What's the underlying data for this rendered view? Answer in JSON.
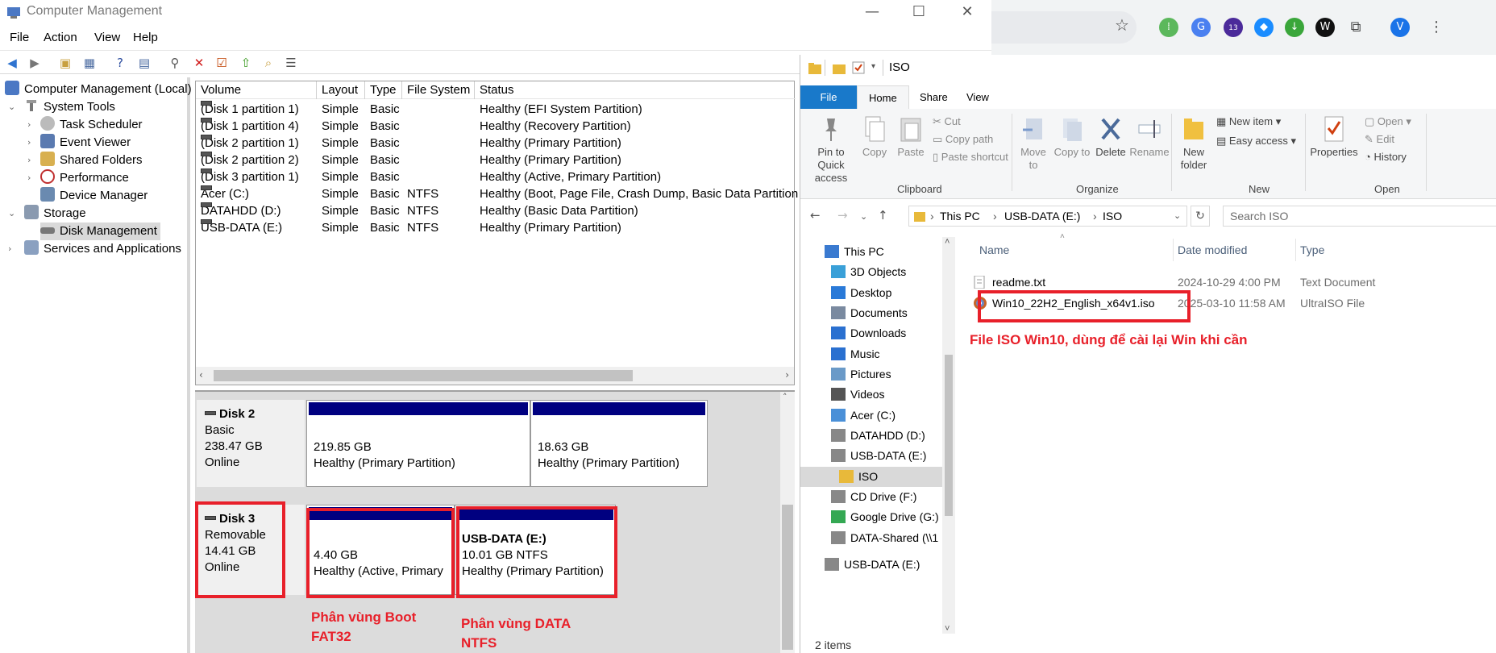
{
  "browser": {
    "extension_badge": "13",
    "profile_initial": "V"
  },
  "cm": {
    "title": "Computer Management",
    "menu": [
      "File",
      "Action",
      "View",
      "Help"
    ],
    "tree": {
      "root": "Computer Management (Local)",
      "system_tools": "System Tools",
      "task_scheduler": "Task Scheduler",
      "event_viewer": "Event Viewer",
      "shared_folders": "Shared Folders",
      "performance": "Performance",
      "device_manager": "Device Manager",
      "storage": "Storage",
      "disk_management": "Disk Management",
      "services": "Services and Applications"
    },
    "columns": [
      "Volume",
      "Layout",
      "Type",
      "File System",
      "Status"
    ],
    "volumes": [
      {
        "name": "(Disk 1 partition 1)",
        "layout": "Simple",
        "type": "Basic",
        "fs": "",
        "status": "Healthy (EFI System Partition)"
      },
      {
        "name": "(Disk 1 partition 4)",
        "layout": "Simple",
        "type": "Basic",
        "fs": "",
        "status": "Healthy (Recovery Partition)"
      },
      {
        "name": "(Disk 2 partition 1)",
        "layout": "Simple",
        "type": "Basic",
        "fs": "",
        "status": "Healthy (Primary Partition)"
      },
      {
        "name": "(Disk 2 partition 2)",
        "layout": "Simple",
        "type": "Basic",
        "fs": "",
        "status": "Healthy (Primary Partition)"
      },
      {
        "name": "(Disk 3 partition 1)",
        "layout": "Simple",
        "type": "Basic",
        "fs": "",
        "status": "Healthy (Active, Primary Partition)"
      },
      {
        "name": "Acer (C:)",
        "layout": "Simple",
        "type": "Basic",
        "fs": "NTFS",
        "status": "Healthy (Boot, Page File, Crash Dump, Basic Data Partition"
      },
      {
        "name": "DATAHDD (D:)",
        "layout": "Simple",
        "type": "Basic",
        "fs": "NTFS",
        "status": "Healthy (Basic Data Partition)"
      },
      {
        "name": "USB-DATA (E:)",
        "layout": "Simple",
        "type": "Basic",
        "fs": "NTFS",
        "status": "Healthy (Primary Partition)"
      }
    ],
    "disk2": {
      "name": "Disk 2",
      "kind": "Basic",
      "size": "238.47 GB",
      "state": "Online",
      "p1_size": "219.85 GB",
      "p1_status": "Healthy (Primary Partition)",
      "p2_size": "18.63 GB",
      "p2_status": "Healthy (Primary Partition)"
    },
    "disk3": {
      "name": "Disk 3",
      "kind": "Removable",
      "size": "14.41 GB",
      "state": "Online",
      "p1_size": "4.40 GB",
      "p1_status": "Healthy (Active, Primary",
      "p2_label": "USB-DATA  (E:)",
      "p2_size": "10.01 GB NTFS",
      "p2_status": "Healthy (Primary Partition)"
    },
    "annotations": {
      "boot": "Phân vùng Boot FAT32",
      "data": "Phân vùng DATA NTFS"
    }
  },
  "explorer": {
    "title": "ISO",
    "tabs": [
      "File",
      "Home",
      "Share",
      "View"
    ],
    "ribbon": {
      "pin": "Pin to Quick access",
      "copy": "Copy",
      "paste": "Paste",
      "cut": "Cut",
      "copy_path": "Copy path",
      "paste_shortcut": "Paste shortcut",
      "clipboard": "Clipboard",
      "move_to": "Move to",
      "copy_to": "Copy to",
      "delete": "Delete",
      "rename": "Rename",
      "organize": "Organize",
      "new_folder": "New folder",
      "new_item": "New item",
      "easy_access": "Easy access",
      "new_group": "New",
      "properties": "Properties",
      "open": "Open",
      "edit": "Edit",
      "history": "History",
      "open_group": "Open"
    },
    "address": [
      "This PC",
      "USB-DATA (E:)",
      "ISO"
    ],
    "search_placeholder": "Search ISO",
    "nav": [
      "This PC",
      "3D Objects",
      "Desktop",
      "Documents",
      "Downloads",
      "Music",
      "Pictures",
      "Videos",
      "Acer (C:)",
      "DATAHDD (D:)",
      "USB-DATA (E:)",
      "ISO",
      "CD Drive (F:)",
      "Google Drive (G:)",
      "DATA-Shared (\\\\1",
      "USB-DATA (E:)"
    ],
    "columns": [
      "Name",
      "Date modified",
      "Type"
    ],
    "files": [
      {
        "name": "readme.txt",
        "date": "2024-10-29 4:00 PM",
        "type": "Text Document"
      },
      {
        "name": "Win10_22H2_English_x64v1.iso",
        "date": "2025-03-10 11:58 AM",
        "type": "UltraISO File"
      }
    ],
    "annotation": "File ISO Win10, dùng để cài lại Win khi cần",
    "status": "2 items"
  },
  "colors": {
    "annotation_red": "#e8202a",
    "partition_bar": "#000080",
    "selected_tab": "#1979ca"
  }
}
